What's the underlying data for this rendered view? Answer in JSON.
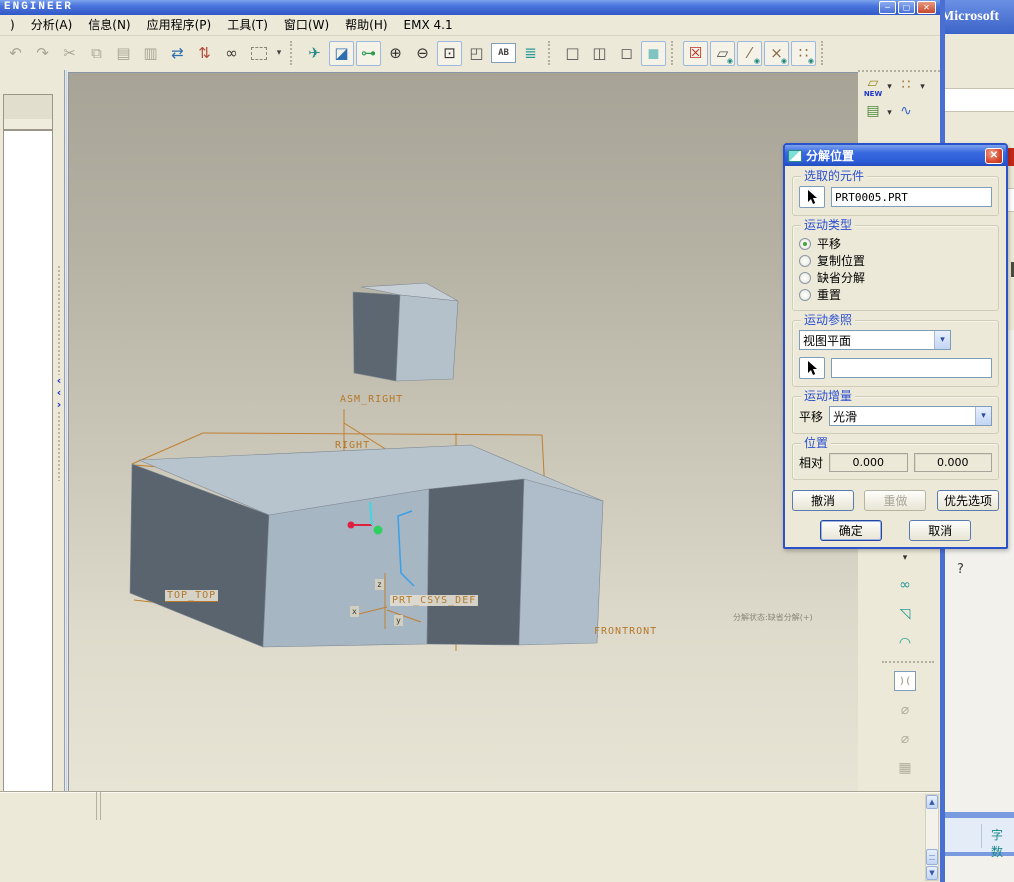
{
  "window": {
    "title": "ENGINEER",
    "controls": {
      "minimize": "─",
      "maximize": "▢",
      "close": "✕"
    }
  },
  "glyphs": {
    "caret": "▾",
    "up": "▲",
    "down": "▼"
  },
  "menu": {
    "items": [
      {
        "name": "menu-clipped",
        "label": ")"
      },
      {
        "name": "menu-analysis",
        "label": "分析(A)"
      },
      {
        "name": "menu-info",
        "label": "信息(N)"
      },
      {
        "name": "menu-applications",
        "label": "应用程序(P)"
      },
      {
        "name": "menu-tools",
        "label": "工具(T)"
      },
      {
        "name": "menu-window",
        "label": "窗口(W)"
      },
      {
        "name": "menu-help",
        "label": "帮助(H)"
      },
      {
        "name": "menu-emx",
        "label": "EMX 4.1"
      }
    ]
  },
  "toolbar": {
    "group1": [
      {
        "name": "undo-icon",
        "glyph": "↶",
        "color": "#a9a595"
      },
      {
        "name": "redo-icon",
        "glyph": "↷",
        "color": "#a9a595"
      },
      {
        "name": "cut-icon",
        "glyph": "✂",
        "color": "#a9a595"
      },
      {
        "name": "copy-icon",
        "glyph": "⧉",
        "color": "#a9a595"
      },
      {
        "name": "paste-icon",
        "glyph": "▤",
        "color": "#a9a595"
      },
      {
        "name": "paste-special-icon",
        "glyph": "▥",
        "color": "#a9a595"
      },
      {
        "name": "regenerate-icon",
        "glyph": "⇄",
        "color": "#2f6fb0"
      },
      {
        "name": "regenerate-manager-icon",
        "glyph": "⇅",
        "color": "#b84a3a"
      },
      {
        "name": "find-icon",
        "glyph": "∞",
        "color": "#3a3a30"
      },
      {
        "name": "select-box-icon",
        "glyph": "",
        "color": "#888",
        "cls": "dashed-box"
      },
      {
        "name": "select-caret-icon",
        "glyph": "▾",
        "color": "#444",
        "cls": "narrow"
      }
    ],
    "group2": [
      {
        "name": "fly-through-icon",
        "glyph": "✈",
        "color": "#2a8a8a"
      },
      {
        "name": "repaint-icon",
        "glyph": "◪",
        "color": "#2f6fb0",
        "pressed": true
      },
      {
        "name": "spin-center-icon",
        "glyph": "⊶",
        "color": "#2a9a50",
        "pressed": true
      },
      {
        "name": "zoom-in-icon",
        "glyph": "⊕",
        "color": "#333333"
      },
      {
        "name": "zoom-out-icon",
        "glyph": "⊖",
        "color": "#333333"
      },
      {
        "name": "zoom-fit-icon",
        "glyph": "⊡",
        "color": "#333333",
        "pressed": true
      },
      {
        "name": "reorient-icon",
        "glyph": "◰",
        "color": "#555555"
      },
      {
        "name": "saved-views-icon",
        "glyph": "AB",
        "color": "#444444",
        "cls": "txt"
      },
      {
        "name": "layers-icon",
        "glyph": "≣",
        "color": "#2a9a96"
      }
    ],
    "group3": [
      {
        "name": "wireframe-icon",
        "glyph": "□",
        "color": "#555555"
      },
      {
        "name": "hidden-line-icon",
        "glyph": "◫",
        "color": "#555555"
      },
      {
        "name": "no-hidden-icon",
        "glyph": "◻",
        "color": "#555555"
      },
      {
        "name": "shaded-icon",
        "glyph": "◼",
        "color": "#7fc4c0",
        "pressed": true
      }
    ],
    "group4": [
      {
        "name": "datum-planes-toggle-icon",
        "glyph": "☒",
        "color": "#c03028",
        "pressed": true
      },
      {
        "name": "plane-display-icon",
        "glyph": "▱",
        "color": "#555555",
        "sub": "◉",
        "pressed": true
      },
      {
        "name": "axis-display-icon",
        "glyph": "⁄",
        "color": "#8a6a4a",
        "sub": "◉",
        "pressed": true
      },
      {
        "name": "csys-display-icon",
        "glyph": "×",
        "color": "#8a6a4a",
        "sub": "◉",
        "pressed": true
      },
      {
        "name": "points-display-icon",
        "glyph": "∷",
        "color": "#8a6a4a",
        "sub": "◉",
        "pressed": true
      }
    ]
  },
  "left_sash": {
    "chevrons": [
      {
        "name": "collapse-left-icon",
        "glyph": "‹"
      },
      {
        "name": "collapse-left2-icon",
        "glyph": "‹"
      },
      {
        "name": "expand-right-icon",
        "glyph": "›"
      }
    ]
  },
  "right_toolbar": {
    "new_label": "NEW",
    "row1": [
      {
        "name": "datum-plane-new-icon",
        "glyph": "▱",
        "color": "#9a8a2a",
        "label": "NEW"
      },
      {
        "name": "caret-icon",
        "glyph": "▾",
        "color": "#333333",
        "cls": "narrow"
      },
      {
        "name": "datum-point-icon",
        "glyph": "∷",
        "color": "#a0703a"
      },
      {
        "name": "caret-icon",
        "glyph": "▾",
        "color": "#333333",
        "cls": "narrow"
      }
    ],
    "row2": [
      {
        "name": "datum-display-icon",
        "glyph": "▤",
        "color": "#4a8a3a"
      },
      {
        "name": "caret-icon",
        "glyph": "▾",
        "color": "#333333",
        "cls": "narrow"
      },
      {
        "name": "sketch-icon",
        "glyph": "∿",
        "color": "#3a6ad0"
      }
    ],
    "lower_teal": [
      {
        "name": "caret-icon",
        "glyph": "▾",
        "color": "#333333",
        "cls": "narrow"
      },
      {
        "name": "style-icon",
        "glyph": "∞",
        "color": "#2a9a96"
      },
      {
        "name": "extrude-icon",
        "glyph": "◹",
        "color": "#2a9a96"
      },
      {
        "name": "revolve-icon",
        "glyph": "◠",
        "color": "#2a9a96"
      }
    ],
    "lower_gray": [
      {
        "name": "round-icon",
        "glyph": ")(",
        "color": "#b2ae9e",
        "cls": "txt"
      },
      {
        "name": "hole-icon",
        "glyph": "⌀",
        "color": "#b2ae9e"
      },
      {
        "name": "shell-icon",
        "glyph": "⌀",
        "color": "#b2ae9e"
      },
      {
        "name": "pattern-icon",
        "glyph": "▦",
        "color": "#b2ae9e"
      }
    ]
  },
  "viewport": {
    "labels": {
      "asm_right": "ASM_RIGHT",
      "right": "RIGHT",
      "top_top": "TOP_TOP",
      "prt_csys_def": "PRT_CSYS_DEF",
      "frontront": "FRONTRONT",
      "axis_x": "x",
      "axis_y": "y",
      "axis_z": "z"
    },
    "status_text": "分解状态:缺省分解(+)"
  },
  "dialog": {
    "title": "分解位置",
    "selected_component": {
      "label": "选取的元件",
      "value": "PRT0005.PRT"
    },
    "motion_type": {
      "label": "运动类型",
      "options": [
        {
          "name": "radio-translate",
          "label": "平移",
          "selected": true
        },
        {
          "name": "radio-copy-position",
          "label": "复制位置"
        },
        {
          "name": "radio-default-explode",
          "label": "缺省分解"
        },
        {
          "name": "radio-reset",
          "label": "重置"
        }
      ]
    },
    "motion_reference": {
      "label": "运动参照",
      "dropdown_value": "视图平面",
      "picker_value": ""
    },
    "motion_increment": {
      "label": "运动增量",
      "row_label": "平移",
      "dropdown_value": "光滑"
    },
    "position": {
      "label": "位置",
      "row_label": "相对",
      "value1": "0.000",
      "value2": "0.000"
    },
    "buttons": {
      "undo": "撤消",
      "redo": "重做",
      "preferences": "优先选项",
      "ok": "确定",
      "cancel": "取消"
    }
  },
  "background_window": {
    "title": "Microsoft",
    "help": "?",
    "status": "字数"
  },
  "colors": {
    "titlebar_blue": "#2b5bd6",
    "dialog_label_blue": "#2b4fd0",
    "wireframe_orange": "#c08030",
    "label_orange": "#b5782a",
    "model_dark_face": "#5a646f",
    "model_light_face": "#b7c3cd",
    "viewport_top": "#a7a396",
    "viewport_bottom": "#e8e4d5",
    "panel_beige": "#ece9d8"
  }
}
